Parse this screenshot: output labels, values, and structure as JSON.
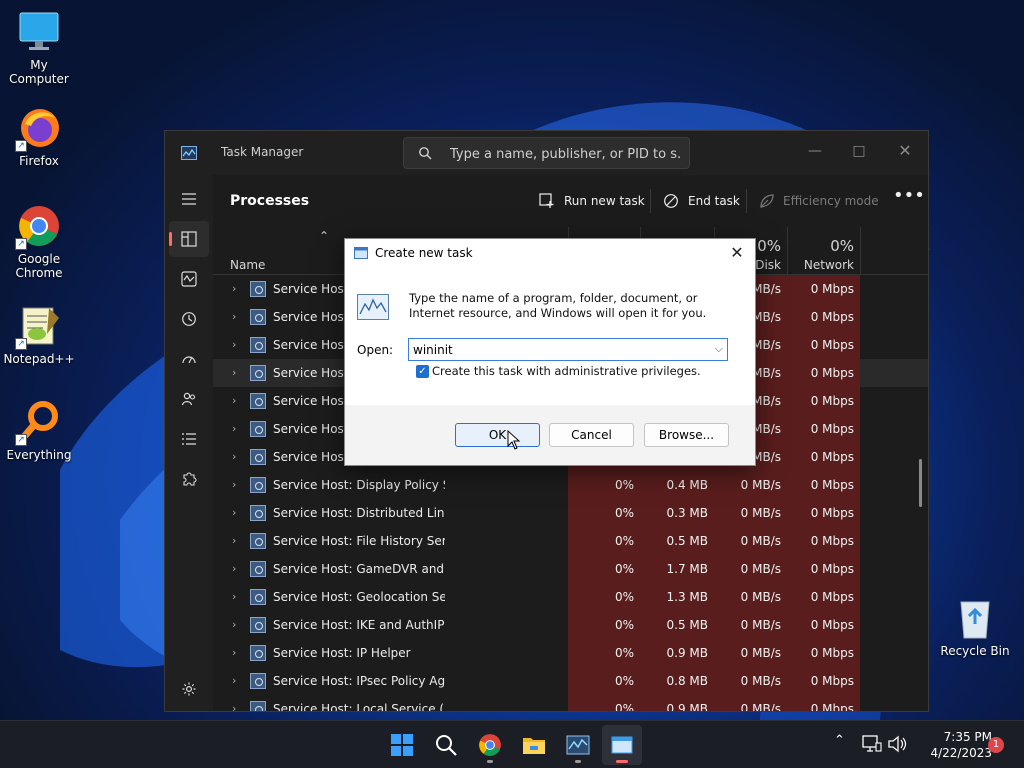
{
  "desktop": {
    "icons": [
      {
        "label": "My Computer"
      },
      {
        "label": "Firefox"
      },
      {
        "label": "Google Chrome"
      },
      {
        "label": "Notepad++"
      },
      {
        "label": "Everything"
      },
      {
        "label": "Recycle Bin"
      }
    ]
  },
  "task_manager": {
    "title": "Task Manager",
    "search_placeholder": "Type a name, publisher, or PID to s...",
    "heading": "Processes",
    "toolbar": {
      "run_new_task": "Run new task",
      "end_task": "End task",
      "efficiency_mode": "Efficiency mode"
    },
    "columns": {
      "name": "Name",
      "disk_pct": "0%",
      "disk": "Disk",
      "network_pct": "0%",
      "network": "Network"
    },
    "rows": [
      {
        "name": "Service Host: C",
        "cpu": "",
        "mem": "",
        "disk": "MB/s",
        "net": "0 Mbps"
      },
      {
        "name": "Service Host: C",
        "cpu": "",
        "mem": "",
        "disk": "MB/s",
        "net": "0 Mbps"
      },
      {
        "name": "Service Host: C",
        "cpu": "",
        "mem": "",
        "disk": "MB/s",
        "net": "0 Mbps"
      },
      {
        "name": "Service Host: C",
        "cpu": "",
        "mem": "",
        "disk": "MB/s",
        "net": "0 Mbps"
      },
      {
        "name": "Service Host: C",
        "cpu": "",
        "mem": "",
        "disk": "MB/s",
        "net": "0 Mbps"
      },
      {
        "name": "Service Host: C",
        "cpu": "",
        "mem": "",
        "disk": "MB/s",
        "net": "0 Mbps"
      },
      {
        "name": "Service Host: C",
        "cpu": "",
        "mem": "",
        "disk": "MB/s",
        "net": "0 Mbps"
      },
      {
        "name": "Service Host: Display Policy Se...",
        "cpu": "0%",
        "mem": "0.4 MB",
        "disk": "0 MB/s",
        "net": "0 Mbps"
      },
      {
        "name": "Service Host: Distributed Link ...",
        "cpu": "0%",
        "mem": "0.3 MB",
        "disk": "0 MB/s",
        "net": "0 Mbps"
      },
      {
        "name": "Service Host: File History Servi...",
        "cpu": "0%",
        "mem": "0.5 MB",
        "disk": "0 MB/s",
        "net": "0 Mbps"
      },
      {
        "name": "Service Host: GameDVR and B...",
        "cpu": "0%",
        "mem": "1.7 MB",
        "disk": "0 MB/s",
        "net": "0 Mbps"
      },
      {
        "name": "Service Host: Geolocation Serv...",
        "cpu": "0%",
        "mem": "1.3 MB",
        "disk": "0 MB/s",
        "net": "0 Mbps"
      },
      {
        "name": "Service Host: IKE and AuthIP I...",
        "cpu": "0%",
        "mem": "0.5 MB",
        "disk": "0 MB/s",
        "net": "0 Mbps"
      },
      {
        "name": "Service Host: IP Helper",
        "cpu": "0%",
        "mem": "0.9 MB",
        "disk": "0 MB/s",
        "net": "0 Mbps"
      },
      {
        "name": "Service Host: IPsec Policy Agent",
        "cpu": "0%",
        "mem": "0.8 MB",
        "disk": "0 MB/s",
        "net": "0 Mbps"
      },
      {
        "name": "Service Host: Local Service (N...",
        "cpu": "0%",
        "mem": "0.9 MB",
        "disk": "0 MB/s",
        "net": "0 Mbps"
      }
    ]
  },
  "dialog": {
    "title": "Create new task",
    "message": "Type the name of a program, folder, document, or Internet resource, and Windows will open it for you.",
    "open_label": "Open:",
    "open_value": "wininit",
    "admin_label": "Create this task with administrative privileges.",
    "admin_checked": true,
    "ok": "OK",
    "cancel": "Cancel",
    "browse": "Browse..."
  },
  "taskbar": {
    "time": "7:35 PM",
    "date": "4/22/2023",
    "notification_count": "1"
  },
  "colors": {
    "accent": "#ff6a6a",
    "heat_cell": "#5a1d1d",
    "dialog_primary": "#2a6fd6"
  }
}
